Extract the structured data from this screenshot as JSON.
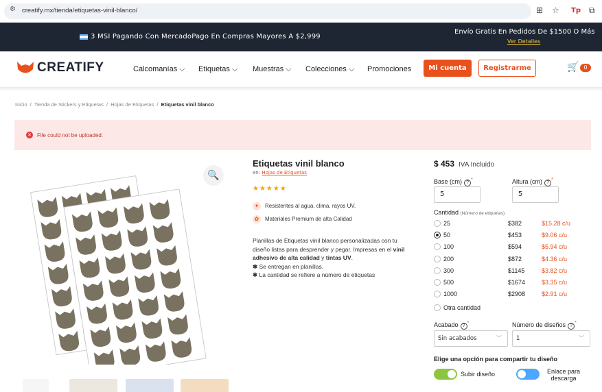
{
  "browser": {
    "url": "creatify.mx/tienda/etiquetas-vinil-blanco/"
  },
  "promo": {
    "left_text": "3 MSI Pagando Con MercadoPago En Compras Mayores A $2,999",
    "right_text": "Envío Gratis En Pedidos De $1500 O Más",
    "right_link": "Ver Detalles"
  },
  "header": {
    "logo": "CREATIFY",
    "nav": [
      "Calcomanías",
      "Etiquetas",
      "Muestras",
      "Colecciones",
      "Promociones"
    ],
    "account_button": "Mi cuenta",
    "register_button": "Registrarme",
    "cart_count": "0"
  },
  "breadcrumb": {
    "items": [
      "Inicio",
      "Tienda de Stickers y Etiquetas",
      "Hojas de Etiquetas"
    ],
    "current": "Etiquetas vinil blanco"
  },
  "error": {
    "message": "File could not be uploaded."
  },
  "product": {
    "title": "Etiquetas vinil blanco",
    "category_prefix": "en:",
    "category": "Hojas de Etiquetas",
    "stars": "★★★★★",
    "features": [
      "Resistentes al agua, clima, rayos UV.",
      "Materiales Premium de alta Calidad"
    ],
    "desc_1": "Planillas de Etiquetas vinil blanco personalizadas con tu diseño listas para desprender y pegar. Impresas en el ",
    "desc_bold1": "vinil adhesivo de alta calidad",
    "desc_y": " y ",
    "desc_bold2": "tintas UV",
    "desc_end": ".",
    "bullets": [
      "Se entregan en planillas.",
      "La cantidad se refiere a número de etiquetas"
    ]
  },
  "pricing": {
    "price": "$ 453",
    "iva": "IVA Incluido",
    "base_label": "Base (cm)",
    "base_value": "5",
    "height_label": "Altura (cm)",
    "height_value": "5",
    "qty_label": "Cantidad",
    "qty_note": "(Número de etiquetas)",
    "quantities": [
      {
        "qty": "25",
        "price": "$382",
        "unit": "$15.28 c/u",
        "selected": false
      },
      {
        "qty": "50",
        "price": "$453",
        "unit": "$9.06 c/u",
        "selected": true
      },
      {
        "qty": "100",
        "price": "$594",
        "unit": "$5.94 c/u",
        "selected": false
      },
      {
        "qty": "200",
        "price": "$872",
        "unit": "$4.36 c/u",
        "selected": false
      },
      {
        "qty": "300",
        "price": "$1145",
        "unit": "$3.82 c/u",
        "selected": false
      },
      {
        "qty": "500",
        "price": "$1674",
        "unit": "$3.35 c/u",
        "selected": false
      },
      {
        "qty": "1000",
        "price": "$2908",
        "unit": "$2.91 c/u",
        "selected": false
      }
    ],
    "other_qty": "Otra cantidad",
    "finish_label": "Acabado",
    "finish_value": "Sin acabados",
    "designs_label": "Número de diseños",
    "designs_value": "1",
    "share_label": "Elige una opción para compartir tu diseño",
    "upload_label": "Subir diseño",
    "link_label": "Enlace para descarga"
  },
  "colors": {
    "accent": "#e8501c",
    "promo_bg": "#1f2633",
    "sticker": "#7a7260",
    "toggle_on": "#8cc63f",
    "toggle_off": "#4da6ff"
  }
}
